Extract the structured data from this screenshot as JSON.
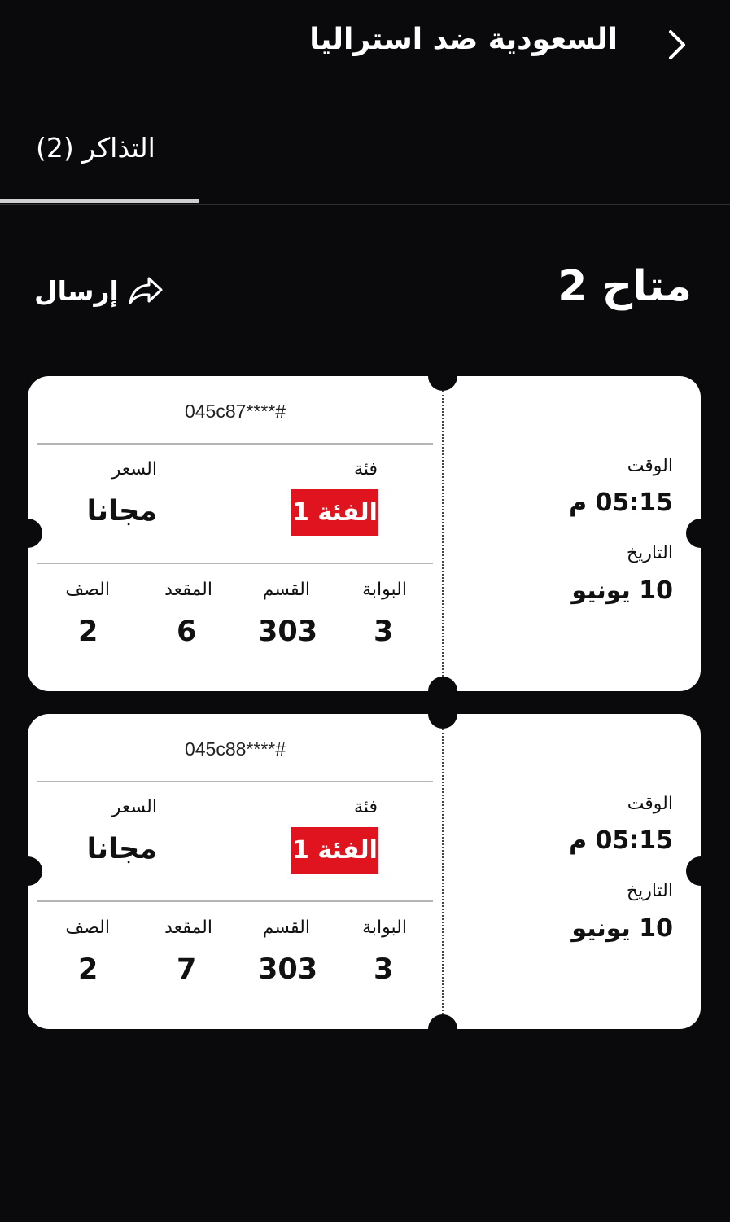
{
  "header": {
    "title": "السعودية ضد استراليا",
    "back_icon": "chevron-right-icon"
  },
  "tabs": [
    {
      "label": "التذاكر (2)",
      "active": true
    }
  ],
  "available": {
    "label": "متاح 2"
  },
  "send": {
    "label": "إرسال",
    "icon": "share-icon"
  },
  "labels": {
    "category": "فئة",
    "price": "السعر",
    "gate": "البوابة",
    "section": "القسم",
    "seat": "المقعد",
    "row": "الصف",
    "time": "الوقت",
    "date": "التاريخ"
  },
  "tickets": [
    {
      "code": "045c87****#",
      "category": "الفئة 1",
      "price": "مجانا",
      "gate": "3",
      "section": "303",
      "seat": "6",
      "row": "2",
      "time": "05:15 م",
      "date": "10 يونيو"
    },
    {
      "code": "045c88****#",
      "category": "الفئة 1",
      "price": "مجانا",
      "gate": "3",
      "section": "303",
      "seat": "7",
      "row": "2",
      "time": "05:15 م",
      "date": "10 يونيو"
    }
  ],
  "colors": {
    "background": "#0a0a0c",
    "accent": "#e0141e",
    "card": "#ffffff"
  }
}
